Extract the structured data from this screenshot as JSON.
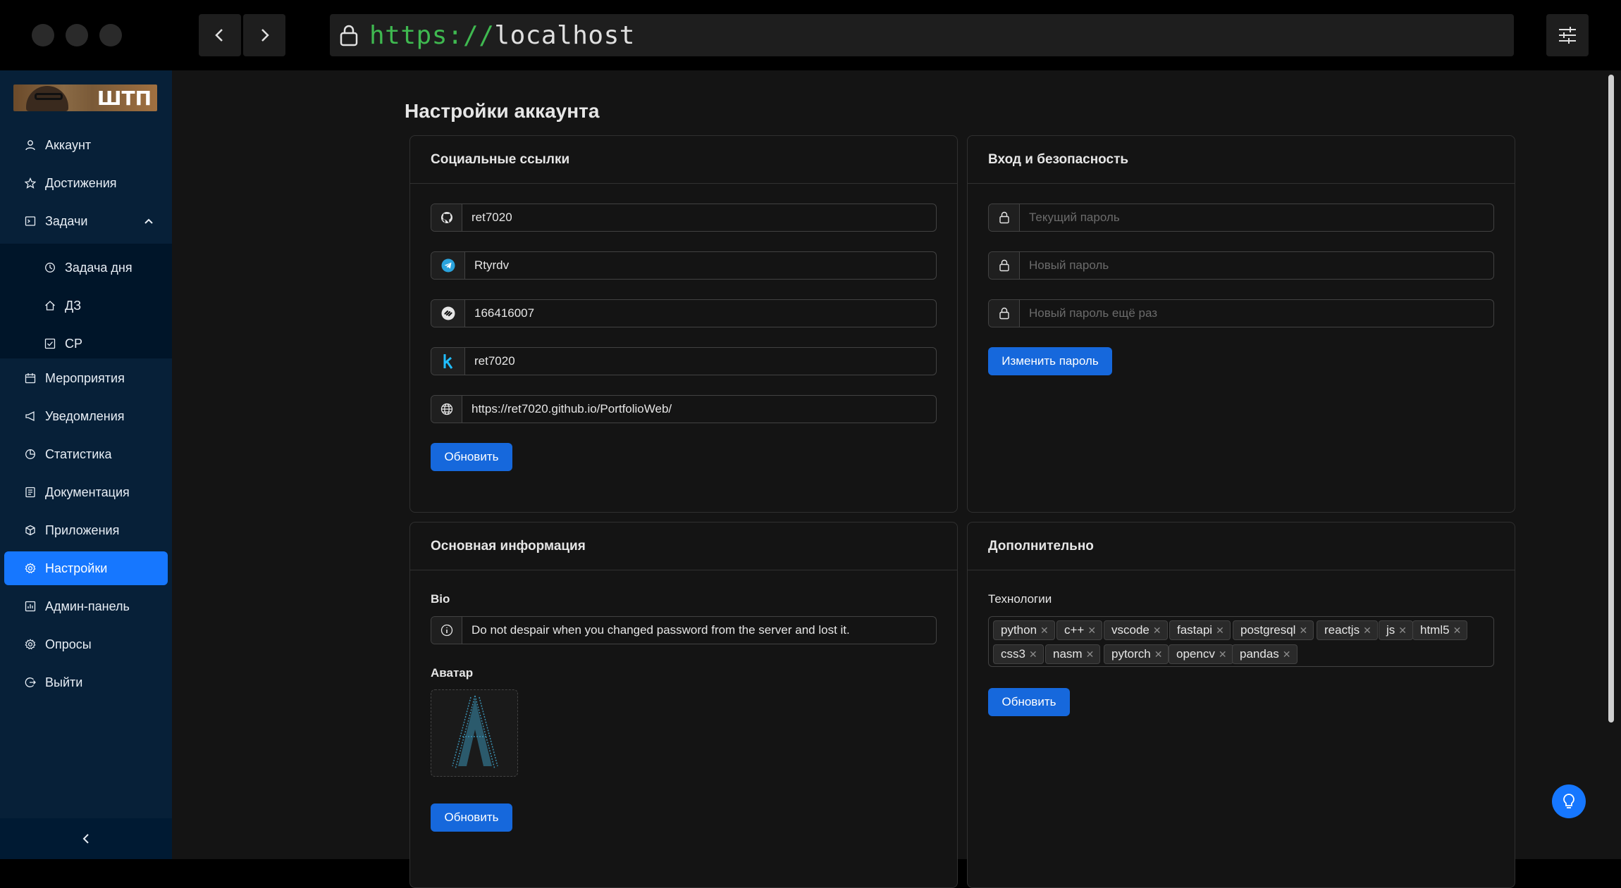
{
  "browser": {
    "url_scheme": "https://",
    "url_host": "localhost"
  },
  "sidebar": {
    "logo_text": "ШТП",
    "items": [
      {
        "label": "Аккаунт",
        "icon": "user-icon"
      },
      {
        "label": "Достижения",
        "icon": "star-icon"
      },
      {
        "label": "Задачи",
        "icon": "terminal-icon"
      },
      {
        "label": "Мероприятия",
        "icon": "calendar-icon"
      },
      {
        "label": "Уведомления",
        "icon": "megaphone-icon"
      },
      {
        "label": "Статистика",
        "icon": "pie-chart-icon"
      },
      {
        "label": "Документация",
        "icon": "document-icon"
      },
      {
        "label": "Приложения",
        "icon": "cube-icon"
      },
      {
        "label": "Настройки",
        "icon": "gear-icon"
      },
      {
        "label": "Админ-панель",
        "icon": "dashboard-icon"
      },
      {
        "label": "Опросы",
        "icon": "gear-icon"
      },
      {
        "label": "Выйти",
        "icon": "logout-icon"
      }
    ],
    "sub_items": [
      {
        "label": "Задача дня",
        "icon": "clock-icon"
      },
      {
        "label": "ДЗ",
        "icon": "home-icon"
      },
      {
        "label": "СР",
        "icon": "checkbox-icon"
      }
    ],
    "active": "Настройки"
  },
  "page": {
    "title": "Настройки аккаунта"
  },
  "social": {
    "title": "Социальные ссылки",
    "github": "ret7020",
    "telegram": "Rtyrdv",
    "stepik": "166416007",
    "kaggle": "ret7020",
    "website": "https://ret7020.github.io/PortfolioWeb/",
    "submit": "Обновить"
  },
  "security": {
    "title": "Вход и безопасность",
    "current_password_placeholder": "Текущий пароль",
    "new_password_placeholder": "Новый пароль",
    "repeat_password_placeholder": "Новый пароль ещё раз",
    "submit": "Изменить пароль"
  },
  "basic": {
    "title": "Основная информация",
    "bio_label": "Bio",
    "bio_value": "Do not despair when you changed password from the server and lost it.",
    "avatar_label": "Аватар",
    "submit": "Обновить"
  },
  "extra": {
    "title": "Дополнительно",
    "tech_label": "Технологии",
    "technologies": [
      "python",
      "c++",
      "vscode",
      "fastapi",
      "postgresql",
      "reactjs",
      "js",
      "html5",
      "css3",
      "nasm",
      "pytorch",
      "opencv",
      "pandas"
    ],
    "submit": "Обновить"
  },
  "colors": {
    "primary": "#1668dc",
    "sidebar_bg": "#072038",
    "sidebar_active": "#1677ff",
    "page_bg": "#141414",
    "url_scheme": "#3fb950"
  }
}
